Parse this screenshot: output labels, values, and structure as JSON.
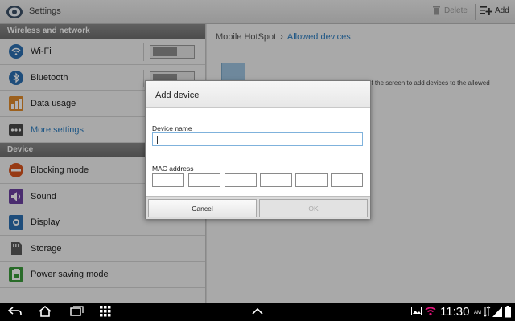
{
  "actionbar": {
    "title": "Settings",
    "delete_label": "Delete",
    "add_label": "Add"
  },
  "sidebar": {
    "sections": [
      {
        "header": "Wireless and network",
        "items": [
          {
            "label": "Wi-Fi",
            "icon": "wifi-icon",
            "toggle": "off"
          },
          {
            "label": "Bluetooth",
            "icon": "bluetooth-icon",
            "toggle": "off"
          },
          {
            "label": "Data usage",
            "icon": "data-usage-icon"
          },
          {
            "label": "More settings",
            "icon": "more-settings-icon",
            "selected": true
          }
        ]
      },
      {
        "header": "Device",
        "items": [
          {
            "label": "Blocking mode",
            "icon": "blocking-mode-icon"
          },
          {
            "label": "Sound",
            "icon": "sound-icon"
          },
          {
            "label": "Display",
            "icon": "display-icon"
          },
          {
            "label": "Storage",
            "icon": "storage-icon"
          },
          {
            "label": "Power saving mode",
            "icon": "power-saving-icon"
          }
        ]
      }
    ]
  },
  "main": {
    "breadcrumb_parent": "Mobile HotSpot",
    "breadcrumb_current": "Allowed devices",
    "hint_text": "of the screen to add devices to the allowed"
  },
  "dialog": {
    "title": "Add device",
    "device_name_label": "Device name",
    "device_name_value": "",
    "mac_label": "MAC address",
    "mac_octets": [
      "",
      "",
      "",
      "",
      "",
      ""
    ],
    "cancel_label": "Cancel",
    "ok_label": "OK"
  },
  "statusbar": {
    "time": "11:30",
    "ampm": "AM"
  },
  "colors": {
    "accent": "#2a7bbf",
    "section_header": "#7a7a7a",
    "navbar": "#000000"
  }
}
